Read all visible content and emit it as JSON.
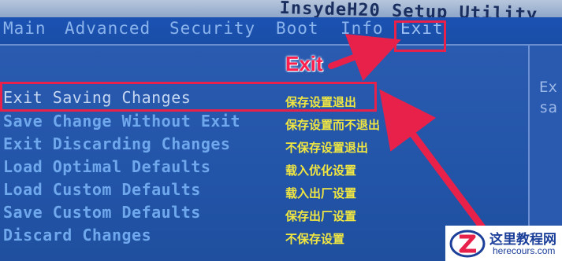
{
  "app_title": "InsydeH20 Setup Utility",
  "tabs": [
    {
      "label": "Main"
    },
    {
      "label": "Advanced"
    },
    {
      "label": "Security"
    },
    {
      "label": "Boot"
    },
    {
      "label": "Info"
    },
    {
      "label": "Exit",
      "active": true
    }
  ],
  "menu_items": [
    {
      "label": "Exit Saving Changes",
      "translation": "保存设置退出",
      "selected": true
    },
    {
      "label": "Save Change Without Exit",
      "translation": "保存设置而不退出"
    },
    {
      "label": "Exit Discarding Changes",
      "translation": "不保存设置退出"
    },
    {
      "label": "Load Optimal Defaults",
      "translation": "载入优化设置"
    },
    {
      "label": "Load Custom Defaults",
      "translation": "载入出厂设置"
    },
    {
      "label": "Save Custom Defaults",
      "translation": "保存出厂设置"
    },
    {
      "label": "Discard Changes",
      "translation": "不保存设置"
    }
  ],
  "help_text": [
    "Ex",
    "sa"
  ],
  "annotation": {
    "callout": "Exit"
  },
  "watermark": {
    "name": "这里教程网",
    "url": "herecours.com"
  },
  "colors": {
    "bios_blue": "#2254a8",
    "highlight_red": "#e8214b",
    "translation_yellow": "#f0e642"
  }
}
